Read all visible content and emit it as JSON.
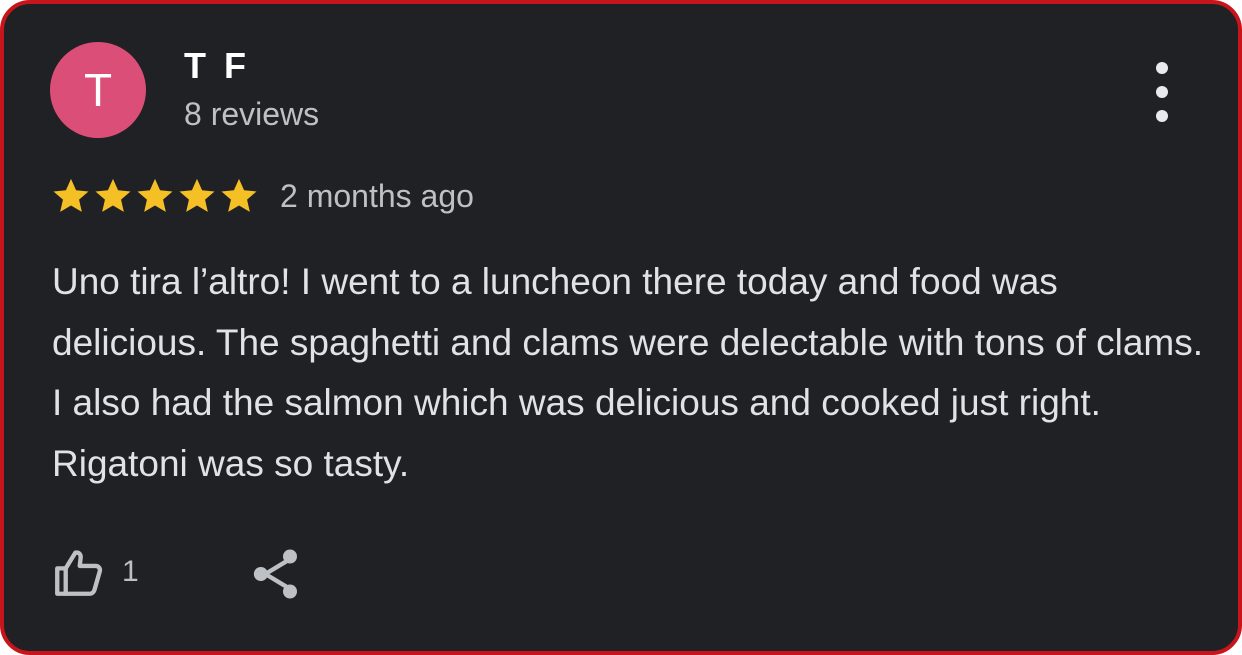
{
  "author": {
    "initial": "T",
    "name": "T F",
    "reviews": "8 reviews",
    "avatar_color": "#db4e78"
  },
  "rating": {
    "stars": 5,
    "max_stars": 5,
    "star_color": "#f5c026",
    "date": "2 months ago"
  },
  "review": {
    "text": "Uno tira l’altro! I went to a luncheon there today and food was delicious. The spaghetti and clams were delectable with tons of clams. I also had the salmon which was delicious and cooked just right. Rigatoni was so tasty."
  },
  "actions": {
    "like_count": "1",
    "like_icon": "thumbs-up-icon",
    "share_icon": "share-icon",
    "more_icon": "more-vert-icon"
  },
  "colors": {
    "card_background": "#202124",
    "border": "#c8141b"
  }
}
